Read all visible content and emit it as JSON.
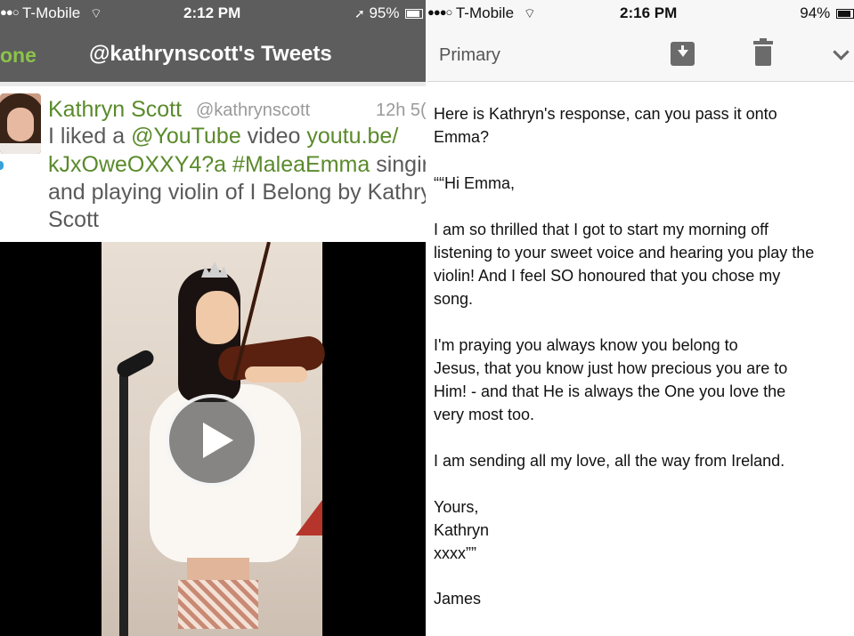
{
  "left": {
    "status": {
      "carrier": "T-Mobile",
      "time": "2:12 PM",
      "battery": "95%",
      "battery_level": 0.95
    },
    "nav": {
      "back_label": "one",
      "title": "@kathrynscott's Tweets"
    },
    "tweet": {
      "name": "Kathryn Scott",
      "handle": "@kathrynscott",
      "time": "12h 5(",
      "line1_prefix": "I liked a ",
      "line1_mention": "@YouTube",
      "line1_mid": " video ",
      "line1_link": "youtu.be/",
      "line2_link": "kJxOweOXXY4?a",
      "line2_space": " ",
      "line2_hashtag": "#MaleaEmma",
      "line2_suffix": " singir",
      "line3": "and playing violin of I Belong by Kathry",
      "line4": "Scott"
    },
    "colors": {
      "link": "#5a8a2b",
      "back": "#8bc34a",
      "navbar": "#5d5d5d"
    }
  },
  "right": {
    "status": {
      "carrier": "T-Mobile",
      "time": "2:16 PM",
      "battery": "94%",
      "battery_level": 0.94
    },
    "nav": {
      "label": "Primary"
    },
    "email_lines": [
      "Here is Kathryn's response, can you pass it onto",
      "Emma?",
      "““Hi Emma,",
      "I am so thrilled that I got to start my morning off",
      "listening to your sweet voice and hearing you play the",
      "violin! And I feel SO honoured that you chose my",
      "song.",
      "I'm praying you always know you belong to",
      "Jesus, that you know just how precious you are to",
      "Him! - and that He is always the One you love the",
      "very most too.",
      "I am sending all my love, all the way from Ireland.",
      "Yours,",
      "Kathryn",
      "xxxx””",
      "James"
    ]
  }
}
